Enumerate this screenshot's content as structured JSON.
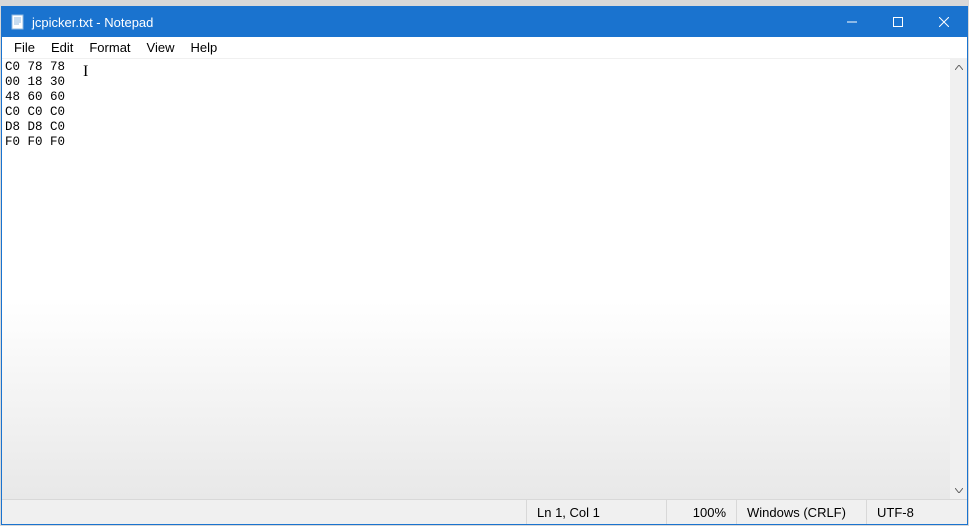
{
  "titlebar": {
    "title": "jcpicker.txt - Notepad"
  },
  "menu": {
    "file": "File",
    "edit": "Edit",
    "format": "Format",
    "view": "View",
    "help": "Help"
  },
  "editor": {
    "content": "C0 78 78\n00 18 30\n48 60 60\nC0 C0 C0\nD8 D8 C0\nF0 F0 F0"
  },
  "statusbar": {
    "position": "Ln 1, Col 1",
    "zoom": "100%",
    "line_ending": "Windows (CRLF)",
    "encoding": "UTF-8"
  }
}
